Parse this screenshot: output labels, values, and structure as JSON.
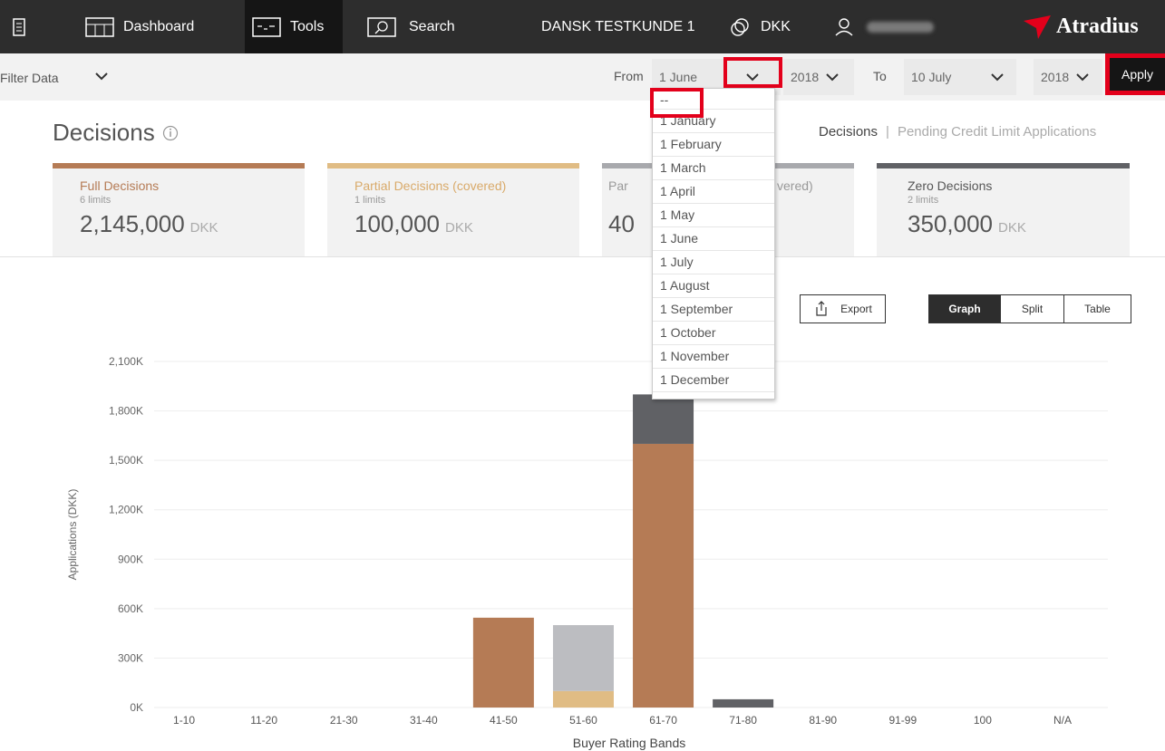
{
  "nav": {
    "dashboard": "Dashboard",
    "tools": "Tools",
    "search": "Search",
    "customer": "DANSK TESTKUNDE 1",
    "currency": "DKK",
    "brand": "Atradius"
  },
  "filter": {
    "label": "Filter Data",
    "from_label": "From",
    "from_day": "1 June",
    "from_year": "2018",
    "to_label": "To",
    "to_day": "10 July",
    "to_year": "2018",
    "apply": "Apply"
  },
  "page": {
    "title": "Decisions",
    "link_decisions": "Decisions",
    "separator": "|",
    "link_pending": "Pending Credit Limit Applications"
  },
  "cards": [
    {
      "title": "Full Decisions",
      "sub": "6 limits",
      "value": "2,145,000",
      "unit": "DKK",
      "color": "#b57b55"
    },
    {
      "title": "Partial Decisions (covered)",
      "sub": "1 limits",
      "value": "100,000",
      "unit": "DKK",
      "color": "#e0bc84"
    },
    {
      "title": "Par",
      "title_end": "vered)",
      "value": "40",
      "color": "#a8a9ad"
    },
    {
      "title": "Zero Decisions",
      "sub": "2 limits",
      "value": "350,000",
      "unit": "DKK",
      "color": "#606165"
    }
  ],
  "toolbar": {
    "export": "Export",
    "graph": "Graph",
    "split": "Split",
    "table": "Table"
  },
  "dropdown": {
    "items": [
      "--",
      "1 January",
      "1 February",
      "1 March",
      "1 April",
      "1 May",
      "1 June",
      "1 July",
      "1 August",
      "1 September",
      "1 October",
      "1 November",
      "1 December"
    ]
  },
  "colors": {
    "full": "#b57b55",
    "partial": "#e0bc84",
    "partial_uncovered": "#bcbdc1",
    "zero": "#606165",
    "highlight": "#e3001b"
  },
  "chart_data": {
    "type": "bar",
    "stacked": true,
    "xlabel": "Buyer Rating Bands",
    "ylabel": "Applications (DKK)",
    "categories": [
      "1-10",
      "11-20",
      "21-30",
      "31-40",
      "41-50",
      "51-60",
      "61-70",
      "71-80",
      "81-90",
      "91-99",
      "100",
      "N/A"
    ],
    "yticks": [
      "0K",
      "300K",
      "600K",
      "900K",
      "1,200K",
      "1,500K",
      "1,800K",
      "2,100K"
    ],
    "ylim": [
      0,
      2100000
    ],
    "series": [
      {
        "color": "#b57b55",
        "values": [
          0,
          0,
          0,
          0,
          545000,
          0,
          1600000,
          0,
          0,
          0,
          0,
          0
        ]
      },
      {
        "color": "#e0bc84",
        "values": [
          0,
          0,
          0,
          0,
          0,
          100000,
          0,
          0,
          0,
          0,
          0,
          0
        ]
      },
      {
        "color": "#bcbdc1",
        "values": [
          0,
          0,
          0,
          0,
          0,
          400000,
          0,
          0,
          0,
          0,
          0,
          0
        ]
      },
      {
        "color": "#606165",
        "values": [
          0,
          0,
          0,
          0,
          0,
          0,
          300000,
          50000,
          0,
          0,
          0,
          0
        ]
      }
    ]
  }
}
